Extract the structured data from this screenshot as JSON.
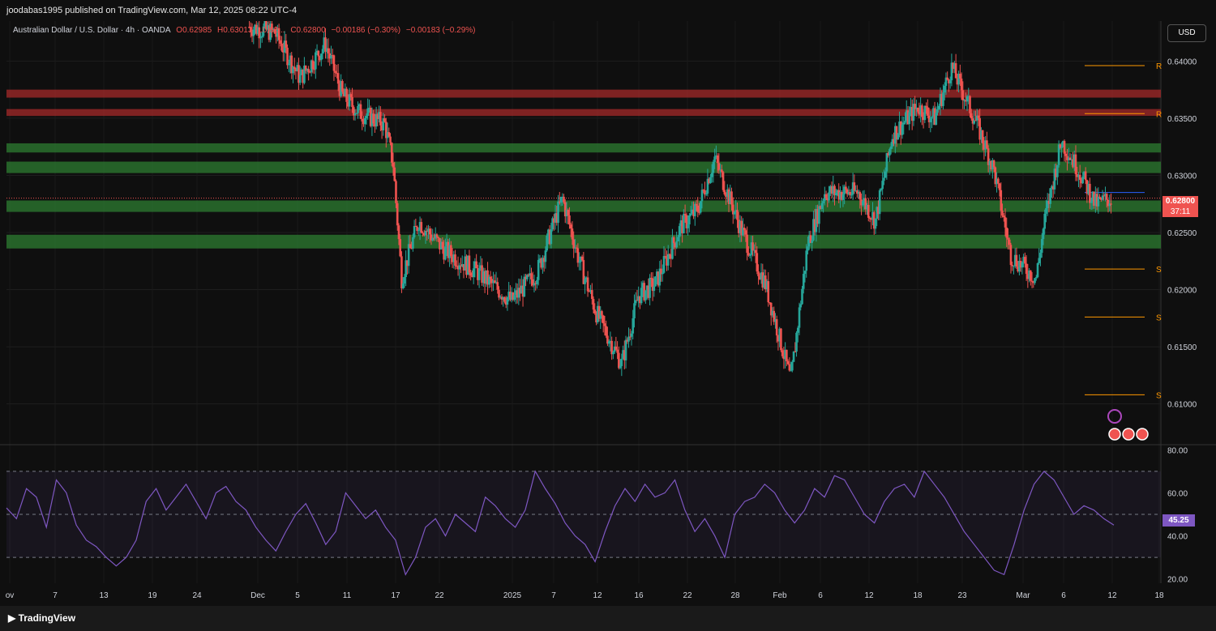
{
  "header": {
    "published": "joodabas1995 published on TradingView.com, Mar 12, 2025 08:22 UTC-4"
  },
  "legend": {
    "symbol": "Australian Dollar / U.S. Dollar · 4h · OANDA",
    "open": "O0.62985",
    "high": "H0.63013",
    "low": "L0.62...",
    "close": "C0.62800",
    "change": "−0.00186 (−0.30%)",
    "change2": "−0.00183 (−0.29%)"
  },
  "currency_button": "USD",
  "price_tag": {
    "value": "0.62800",
    "countdown": "37:11"
  },
  "rsi_tag": "45.25",
  "footer": {
    "brand": "TradingView"
  },
  "colors": {
    "up": "#26a69a",
    "down": "#ef5350",
    "resistance_zone": "#a52a2a",
    "support_zone": "#2e7d32",
    "pivot": "#ff9800",
    "rsi": "#7e57c2",
    "background": "#0f0f0f"
  },
  "chart_data": [
    {
      "type": "candlestick",
      "title": "Australian Dollar / U.S. Dollar · 4h · OANDA",
      "ylim": [
        0.6065,
        0.6435
      ],
      "y_ticks": [
        "0.64000",
        "0.63500",
        "0.63000",
        "0.62500",
        "0.62000",
        "0.61500",
        "0.61000"
      ],
      "x_ticks": [
        "ov",
        "7",
        "13",
        "19",
        "24",
        "Dec",
        "5",
        "11",
        "17",
        "22",
        "2025",
        "7",
        "12",
        "16",
        "22",
        "28",
        "Feb",
        "6",
        "12",
        "18",
        "23",
        "Mar",
        "6",
        "12",
        "18"
      ],
      "price_path": [
        {
          "x": "Nov 30",
          "y": 0.643
        },
        {
          "x": "Dec 3",
          "y": 0.6425
        },
        {
          "x": "Dec 6",
          "y": 0.6385
        },
        {
          "x": "Dec 9",
          "y": 0.6415
        },
        {
          "x": "Dec 11",
          "y": 0.637
        },
        {
          "x": "Dec 13",
          "y": 0.6355
        },
        {
          "x": "Dec 16",
          "y": 0.6345
        },
        {
          "x": "Dec 17",
          "y": 0.631
        },
        {
          "x": "Dec 18",
          "y": 0.621
        },
        {
          "x": "Dec 20",
          "y": 0.626
        },
        {
          "x": "Dec 23",
          "y": 0.6235
        },
        {
          "x": "Dec 27",
          "y": 0.6215
        },
        {
          "x": "Dec 31",
          "y": 0.619
        },
        {
          "x": "Jan 3",
          "y": 0.6215
        },
        {
          "x": "Jan 6",
          "y": 0.628
        },
        {
          "x": "Jan 8",
          "y": 0.6225
        },
        {
          "x": "Jan 10",
          "y": 0.618
        },
        {
          "x": "Jan 13",
          "y": 0.6135
        },
        {
          "x": "Jan 15",
          "y": 0.6195
        },
        {
          "x": "Jan 17",
          "y": 0.6205
        },
        {
          "x": "Jan 20",
          "y": 0.6255
        },
        {
          "x": "Jan 22",
          "y": 0.627
        },
        {
          "x": "Jan 24",
          "y": 0.6315
        },
        {
          "x": "Jan 27",
          "y": 0.6255
        },
        {
          "x": "Jan 30",
          "y": 0.6205
        },
        {
          "x": "Feb 2",
          "y": 0.612
        },
        {
          "x": "Feb 4",
          "y": 0.624
        },
        {
          "x": "Feb 6",
          "y": 0.6285
        },
        {
          "x": "Feb 10",
          "y": 0.6285
        },
        {
          "x": "Feb 12",
          "y": 0.626
        },
        {
          "x": "Feb 14",
          "y": 0.6335
        },
        {
          "x": "Feb 17",
          "y": 0.636
        },
        {
          "x": "Feb 19",
          "y": 0.635
        },
        {
          "x": "Feb 21",
          "y": 0.6395
        },
        {
          "x": "Feb 24",
          "y": 0.6345
        },
        {
          "x": "Feb 26",
          "y": 0.6305
        },
        {
          "x": "Feb 28",
          "y": 0.623
        },
        {
          "x": "Mar 3",
          "y": 0.621
        },
        {
          "x": "Mar 4",
          "y": 0.626
        },
        {
          "x": "Mar 6",
          "y": 0.633
        },
        {
          "x": "Mar 8",
          "y": 0.6305
        },
        {
          "x": "Mar 10",
          "y": 0.6275
        },
        {
          "x": "Mar 12",
          "y": 0.628
        }
      ],
      "resistance_zones": [
        [
          0.6368,
          0.6375
        ],
        [
          0.6352,
          0.6358
        ]
      ],
      "support_zones": [
        [
          0.632,
          0.6328
        ],
        [
          0.6302,
          0.6312
        ],
        [
          0.6268,
          0.6278
        ],
        [
          0.6236,
          0.6248
        ]
      ],
      "pivot_levels": [
        {
          "label": "R",
          "value": 0.6396
        },
        {
          "label": "R",
          "value": 0.6354
        },
        {
          "label": "S",
          "value": 0.6218
        },
        {
          "label": "S",
          "value": 0.6176
        },
        {
          "label": "S",
          "value": 0.6108
        }
      ],
      "last_price": 0.628
    },
    {
      "type": "line",
      "title": "RSI",
      "ylim": [
        18,
        82
      ],
      "y_ticks": [
        "80.00",
        "60.00",
        "40.00",
        "20.00"
      ],
      "bands": [
        30,
        50,
        70
      ],
      "values": [
        53,
        48,
        62,
        58,
        44,
        66,
        60,
        45,
        38,
        35,
        30,
        26,
        30,
        38,
        56,
        62,
        52,
        58,
        64,
        56,
        48,
        60,
        63,
        56,
        52,
        44,
        38,
        33,
        42,
        50,
        55,
        46,
        36,
        42,
        60,
        54,
        48,
        52,
        44,
        38,
        22,
        30,
        44,
        48,
        40,
        50,
        46,
        42,
        58,
        54,
        48,
        44,
        52,
        70,
        62,
        55,
        46,
        40,
        36,
        28,
        42,
        54,
        62,
        56,
        64,
        58,
        60,
        66,
        52,
        42,
        48,
        40,
        30,
        50,
        56,
        58,
        64,
        60,
        52,
        46,
        52,
        62,
        58,
        68,
        66,
        58,
        50,
        46,
        56,
        62,
        64,
        58,
        70,
        64,
        58,
        50,
        42,
        36,
        30,
        24,
        22,
        36,
        52,
        64,
        70,
        66,
        58,
        50,
        54,
        52,
        48,
        45
      ],
      "last_value": 45.25
    }
  ]
}
